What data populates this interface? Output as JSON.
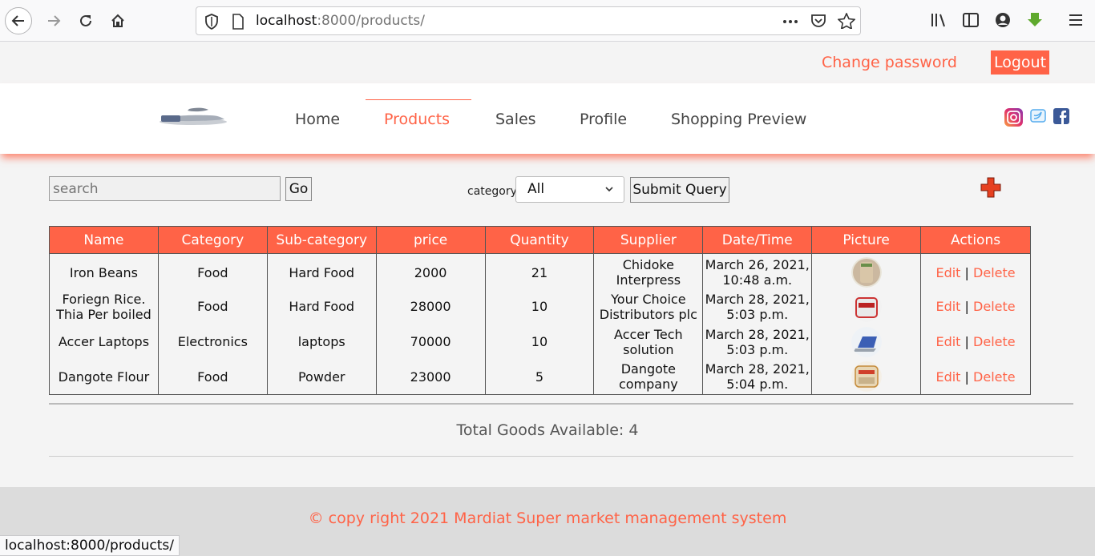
{
  "browser": {
    "url_host": "localhost",
    "url_rest": ":8000/products/",
    "status_url": "localhost:8000/products/"
  },
  "top_links": {
    "change_password": "Change password",
    "logout": "Logout"
  },
  "nav": {
    "items": [
      {
        "label": "Home",
        "active": false
      },
      {
        "label": "Products",
        "active": true
      },
      {
        "label": "Sales",
        "active": false
      },
      {
        "label": "Profile",
        "active": false
      },
      {
        "label": "Shopping Preview",
        "active": false
      }
    ]
  },
  "filters": {
    "search_placeholder": "search",
    "go_label": "Go",
    "category_label": "category",
    "category_value": "All",
    "submit_label": "Submit Query"
  },
  "table": {
    "headers": [
      "Name",
      "Category",
      "Sub-category",
      "price",
      "Quantity",
      "Supplier",
      "Date/Time",
      "Picture",
      "Actions"
    ],
    "rows": [
      {
        "name": "Iron Beans",
        "category": "Food",
        "subcategory": "Hard Food",
        "price": "2000",
        "quantity": "21",
        "supplier": "Chidoke Interpress",
        "datetime": "March 26, 2021, 10:48 a.m.",
        "edit": "Edit",
        "sep": "|",
        "delete": "Delete"
      },
      {
        "name": "Foriegn Rice. Thia Per boiled",
        "category": "Food",
        "subcategory": "Hard Food",
        "price": "28000",
        "quantity": "10",
        "supplier": "Your Choice Distributors plc",
        "datetime": "March 28, 2021, 5:03 p.m.",
        "edit": "Edit",
        "sep": "|",
        "delete": "Delete"
      },
      {
        "name": "Accer Laptops",
        "category": "Electronics",
        "subcategory": "laptops",
        "price": "70000",
        "quantity": "10",
        "supplier": "Accer Tech solution",
        "datetime": "March 28, 2021, 5:03 p.m.",
        "edit": "Edit",
        "sep": "|",
        "delete": "Delete"
      },
      {
        "name": "Dangote Flour",
        "category": "Food",
        "subcategory": "Powder",
        "price": "23000",
        "quantity": "5",
        "supplier": "Dangote company",
        "datetime": "March 28, 2021, 5:04 p.m.",
        "edit": "Edit",
        "sep": "|",
        "delete": "Delete"
      }
    ]
  },
  "summary": {
    "total": "Total Goods Available: 4"
  },
  "footer": {
    "text": "© copy right 2021 Mardiat Super market management system"
  },
  "colors": {
    "accent": "#ff6347",
    "header_bg": "#ffffff",
    "page_bg": "#f4f4f4",
    "footer_bg": "#dcdcdc"
  }
}
